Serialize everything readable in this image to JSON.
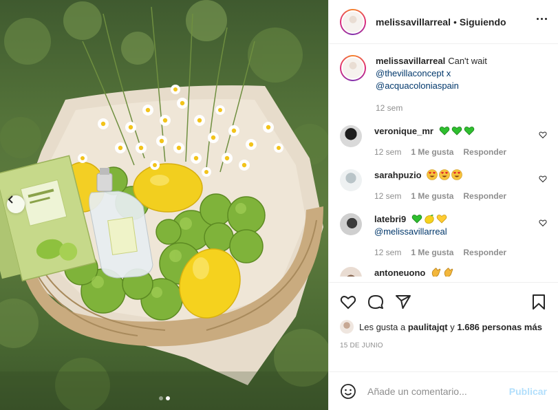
{
  "post": {
    "image_alt": "",
    "carousel": {
      "total": 2,
      "active": 2
    }
  },
  "header": {
    "username": "melissavillarreal",
    "separator": "•",
    "follow_status": "Siguiendo"
  },
  "caption": {
    "username": "melissavillarreal",
    "text": "Can't wait",
    "mentions": [
      "@thevillaconcept x",
      "@acquacoloniaspain"
    ],
    "time": "12 sem"
  },
  "comments": [
    {
      "username": "veronique_mr",
      "text": "",
      "emojis": [
        "green-heart",
        "green-heart",
        "green-heart"
      ],
      "time": "12 sem",
      "likes": "1 Me gusta",
      "reply": "Responder"
    },
    {
      "username": "sarahpuzio",
      "text": "",
      "emojis": [
        "heart-eyes",
        "heart-eyes",
        "heart-eyes"
      ],
      "time": "12 sem",
      "likes": "1 Me gusta",
      "reply": "Responder"
    },
    {
      "username": "latebri9",
      "text": "",
      "emojis": [
        "green-heart",
        "lemon",
        "yellow-heart"
      ],
      "mention": "@melissavillarreal",
      "time": "12 sem",
      "likes": "1 Me gusta",
      "reply": "Responder"
    },
    {
      "username": "antoneuono",
      "text": "",
      "emojis": [
        "clap",
        "clap"
      ]
    }
  ],
  "likes": {
    "prefix": "Les gusta a",
    "user": "paulitajqt",
    "connector": "y",
    "others": "1.686 personas más"
  },
  "date": "15 DE JUNIO",
  "add_comment": {
    "placeholder": "Añade un comentario...",
    "publish_label": "Publicar"
  },
  "colors": {
    "link": "#00376b",
    "muted": "#8e8e8e",
    "publish_disabled": "#b2dffc",
    "green_heart": "#2fbf2f",
    "yellow_heart": "#ffcc33"
  }
}
